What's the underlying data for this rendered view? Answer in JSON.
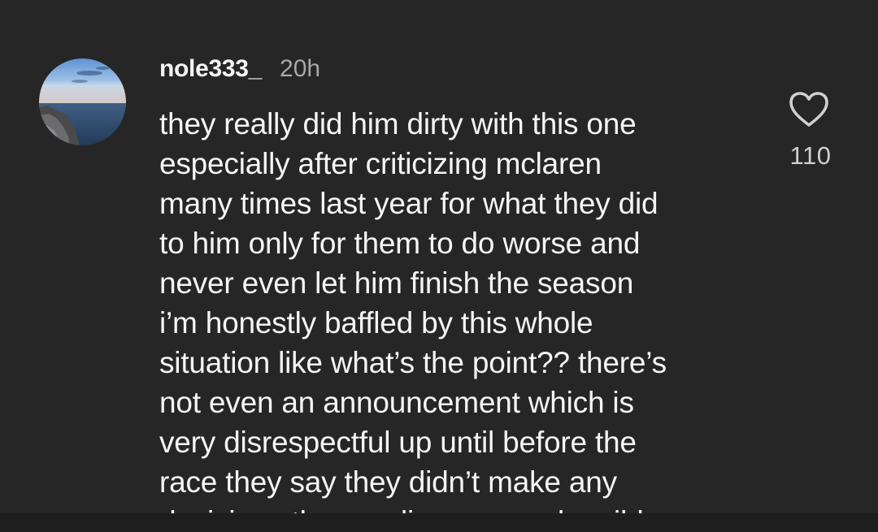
{
  "comment": {
    "username": "nole333_",
    "time": "20h",
    "lines": [
      "they really did him dirty with this one",
      "especially after criticizing mclaren",
      "many times last year for what they did",
      "to him only for them to do worse and",
      "never even let him finish the season",
      "i’m honestly baffled by this whole",
      "situation like what’s the point?? there’s",
      "not even an announcement which is",
      "very disrespectful up until before the",
      "race they say they didn’t make any",
      "decisions then ending on a rude mild"
    ],
    "like_count": "110"
  },
  "icons": {
    "like": "heart-icon"
  },
  "colors": {
    "background": "#262626",
    "text": "#f5f5f5",
    "muted": "#a8a8a8"
  }
}
